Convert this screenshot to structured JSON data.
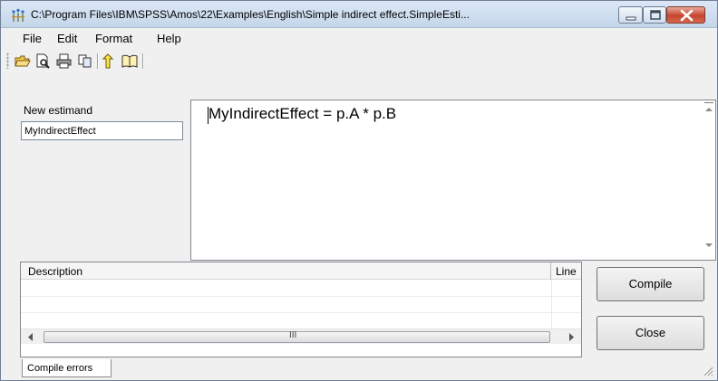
{
  "window": {
    "title": "C:\\Program Files\\IBM\\SPSS\\Amos\\22\\Examples\\English\\Simple indirect effect.SimpleEsti..."
  },
  "menu": {
    "items": [
      "File",
      "Edit",
      "Format",
      "Help"
    ]
  },
  "toolbar": {
    "icons": [
      "open-folder-icon",
      "print-preview-icon",
      "print-icon",
      "copy-icon",
      "help-pointer-icon",
      "book-icon"
    ]
  },
  "estimand": {
    "label": "New estimand",
    "value": "MyIndirectEffect"
  },
  "editor": {
    "code": "MyIndirectEffect = p.A * p.B"
  },
  "errors": {
    "columns": [
      "Description",
      "Line"
    ],
    "rows": [],
    "tab_label": "Compile errors",
    "scroll_grip": "III"
  },
  "buttons": {
    "compile": "Compile",
    "close": "Close"
  },
  "colors": {
    "titlebar": "#c5d6ea",
    "close_button": "#c7442e",
    "window_bg": "#f0f0f0"
  }
}
